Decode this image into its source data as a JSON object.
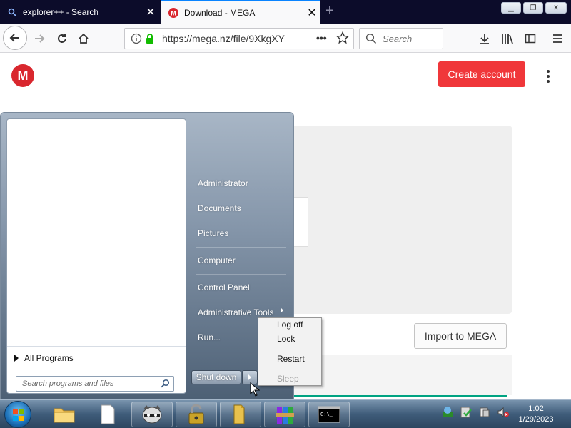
{
  "browser": {
    "tabs": [
      {
        "title": "explorer++ - Search",
        "active": false,
        "icon": "search-icon"
      },
      {
        "title": "Download - MEGA",
        "active": true,
        "icon": "mega-icon"
      }
    ],
    "url": "https://mega.nz/file/9XkgXY",
    "search_placeholder": "Search",
    "accent": "#0a84ff"
  },
  "mega": {
    "logo_letter": "M",
    "create_account": "Create account",
    "import_button": "Import to MEGA",
    "brand_color": "#d9272e",
    "button_color": "#f0373a",
    "progress_color": "#00a382"
  },
  "start_menu": {
    "right_items": [
      "Administrator",
      "Documents",
      "Pictures",
      "Computer",
      "Control Panel",
      "Administrative Tools",
      "Run..."
    ],
    "all_programs": "All Programs",
    "search_placeholder": "Search programs and files",
    "shutdown": "Shut down"
  },
  "shutdown_submenu": {
    "items": [
      "Log off",
      "Lock",
      "Restart",
      "Sleep"
    ],
    "disabled": [
      "Sleep"
    ]
  },
  "taskbar": {
    "apps": [
      "file-explorer",
      "blank-document",
      "raccoon-app",
      "lock-app",
      "folder-app",
      "winrar-app",
      "command-prompt"
    ],
    "tray_icons": [
      "network-icon",
      "security-check-icon",
      "action-center-icon",
      "volume-muted-icon"
    ],
    "time": "1:02",
    "date": "1/29/2023"
  }
}
